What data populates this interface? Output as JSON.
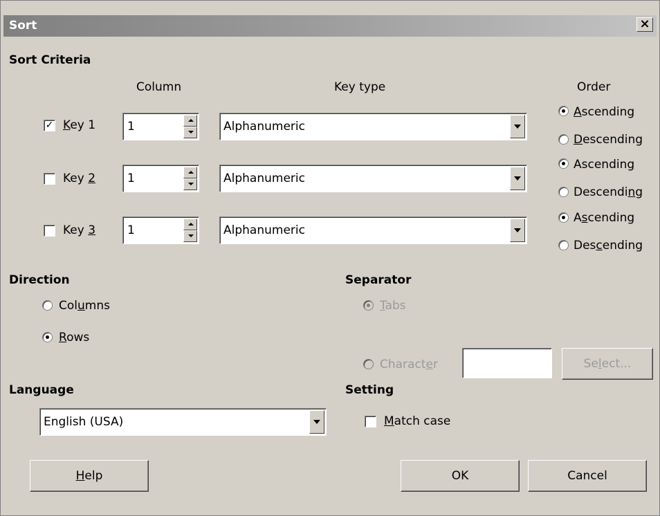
{
  "dialog": {
    "title": "Sort",
    "close_label": "×"
  },
  "sort_criteria": {
    "heading": "Sort Criteria",
    "col_column": "Column",
    "col_key_type": "Key type",
    "col_order": "Order",
    "keys": [
      {
        "label": "Key 1",
        "checked": true,
        "column": "1",
        "key_type": "Alphanumeric",
        "ascending": "Ascending",
        "descending": "Descending",
        "order": "ascending"
      },
      {
        "label": "Key 2",
        "checked": false,
        "column": "1",
        "key_type": "Alphanumeric",
        "ascending": "Ascending",
        "descending": "Descending",
        "order": "ascending"
      },
      {
        "label": "Key 3",
        "checked": false,
        "column": "1",
        "key_type": "Alphanumeric",
        "ascending": "Ascending",
        "descending": "Descending",
        "order": "ascending"
      }
    ]
  },
  "direction": {
    "heading": "Direction",
    "columns": "Columns",
    "rows": "Rows",
    "selected": "rows"
  },
  "separator": {
    "heading": "Separator",
    "tabs": "Tabs",
    "character": "Character",
    "character_value": "",
    "select_button": "Select...",
    "selected": "tabs"
  },
  "language": {
    "heading": "Language",
    "value": "English (USA)"
  },
  "setting": {
    "heading": "Setting",
    "match_case": "Match case",
    "match_case_checked": false
  },
  "buttons": {
    "help": "Help",
    "ok": "OK",
    "cancel": "Cancel"
  },
  "icons": {
    "close": "close-icon",
    "check": "checkmark-icon",
    "dropdown": "dropdown-arrow-icon",
    "spin": "spin-arrows-icon"
  },
  "colors": {
    "dialog_bg": "#d4d0c8",
    "title_text": "#ffffff",
    "disabled_text": "#9a9a9a"
  }
}
